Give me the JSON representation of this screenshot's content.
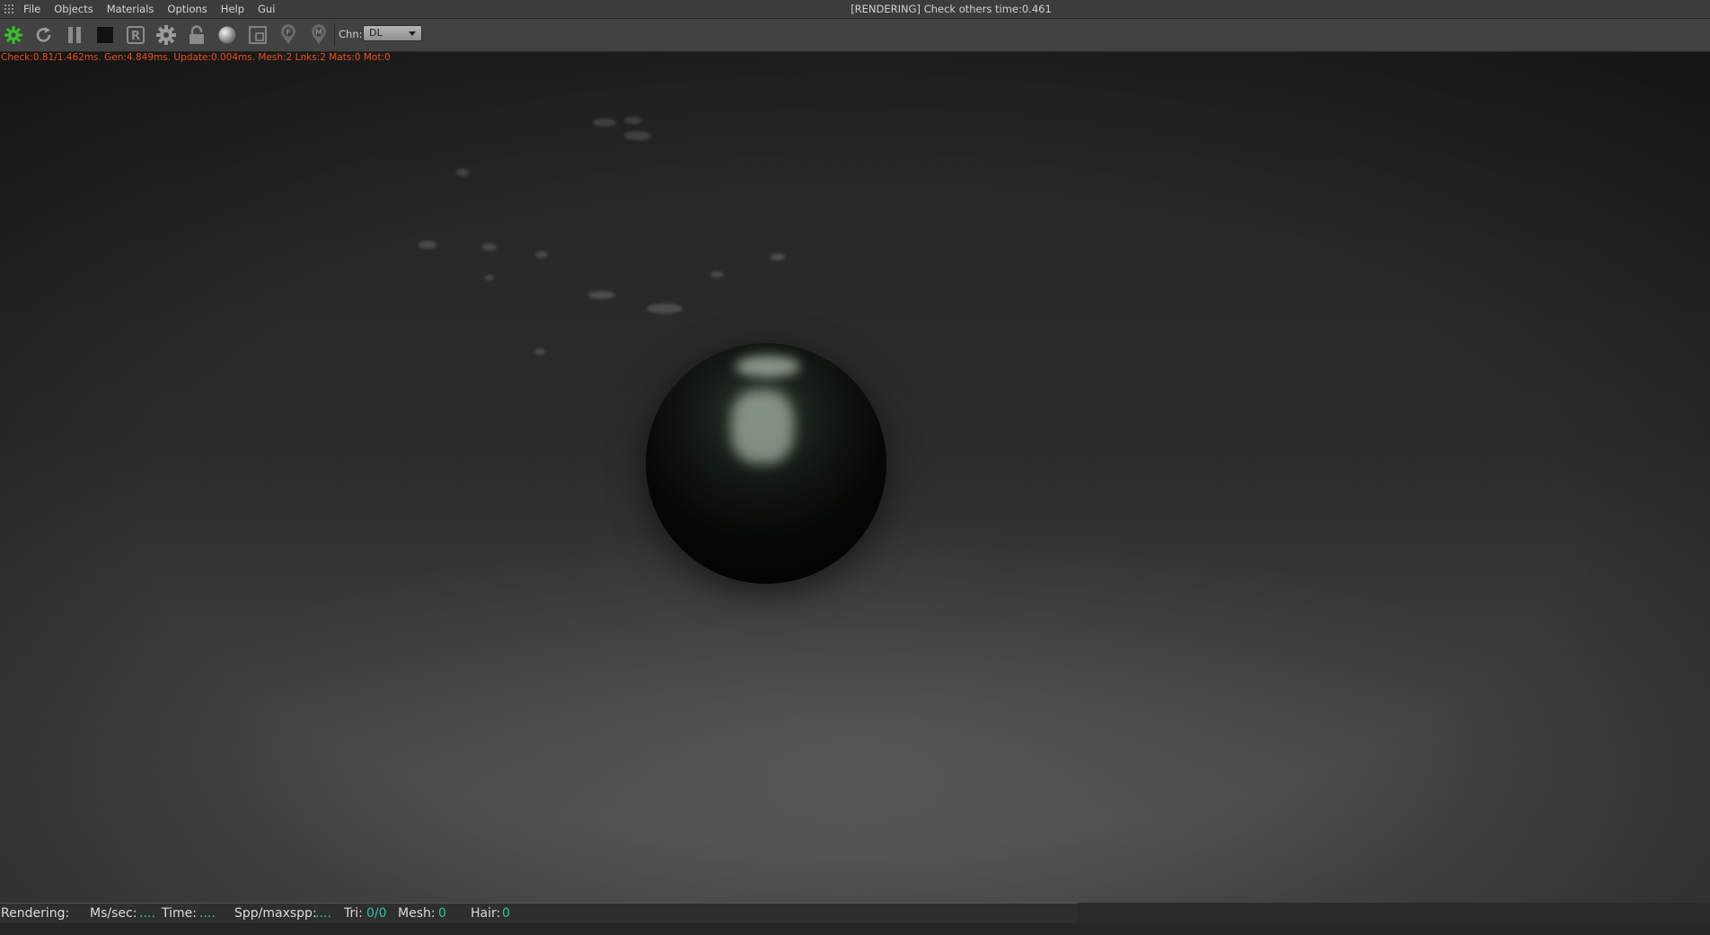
{
  "window": {
    "title": "[RENDERING] Check others time:0.461",
    "menus": [
      "File",
      "Objects",
      "Materials",
      "Options",
      "Help",
      "Gui"
    ]
  },
  "toolbar": {
    "buttons": [
      {
        "name": "start-render-icon"
      },
      {
        "name": "restart-icon"
      },
      {
        "name": "pause-icon"
      },
      {
        "name": "stop-icon"
      },
      {
        "name": "region-render-icon"
      },
      {
        "name": "settings-gear-icon"
      },
      {
        "name": "lock-icon"
      },
      {
        "name": "material-ball-icon"
      },
      {
        "name": "film-region-icon"
      },
      {
        "name": "focus-picker-icon"
      },
      {
        "name": "material-picker-icon"
      }
    ],
    "channel_label": "Chn:",
    "channel_value": "DL"
  },
  "viewport": {
    "stats_overlay": "Check:0.81/1.462ms. Gen:4.849ms. Update:0.004ms. Mesh:2 Lnks:2 Mats:0 Mot:0"
  },
  "statusbar": {
    "rendering_label": "Rendering:",
    "ms_label": "Ms/sec:",
    "ms_value": "....",
    "time_label": "Time:",
    "time_value": "....",
    "spp_label": "Spp/maxspp:",
    "spp_value": "....",
    "tri_label": "Tri:",
    "tri_value": "0/0",
    "mesh_label": "Mesh:",
    "mesh_value": "0",
    "hair_label": "Hair:",
    "hair_value": "0"
  },
  "colors": {
    "accent_green": "#3bbd2a",
    "stats_orange": "#e8521c",
    "status_value_teal": "#33c5a8"
  }
}
